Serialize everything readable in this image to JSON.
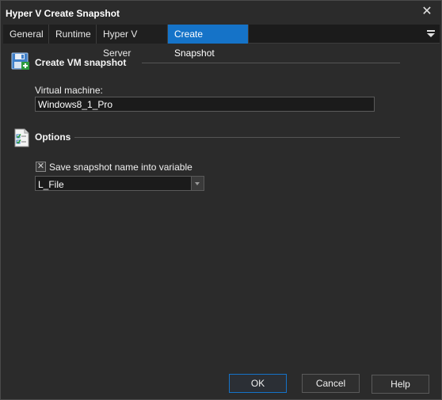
{
  "window": {
    "title": "Hyper V Create Snapshot",
    "close_glyph": "✕"
  },
  "tabs": [
    {
      "label": "General",
      "active": false
    },
    {
      "label": "Runtime",
      "active": false
    },
    {
      "label": "Hyper V Server",
      "active": false
    },
    {
      "label": "Create Snapshot",
      "active": true
    }
  ],
  "tab_menu_icon": "dropdown-menu-icon",
  "section_vm": {
    "icon": "save-disk-icon",
    "title": "Create VM snapshot",
    "virtual_machine_label": "Virtual machine:",
    "virtual_machine_value": "Windows8_1_Pro"
  },
  "section_options": {
    "icon": "checklist-icon",
    "title": "Options",
    "save_checkbox_label": "Save snapshot name into variable",
    "save_checkbox_checked": true,
    "variable_selected": "L_File"
  },
  "buttons": {
    "ok": "OK",
    "cancel": "Cancel",
    "help": "Help"
  },
  "colors": {
    "accent": "#1573c8",
    "background": "#2b2b2b"
  }
}
